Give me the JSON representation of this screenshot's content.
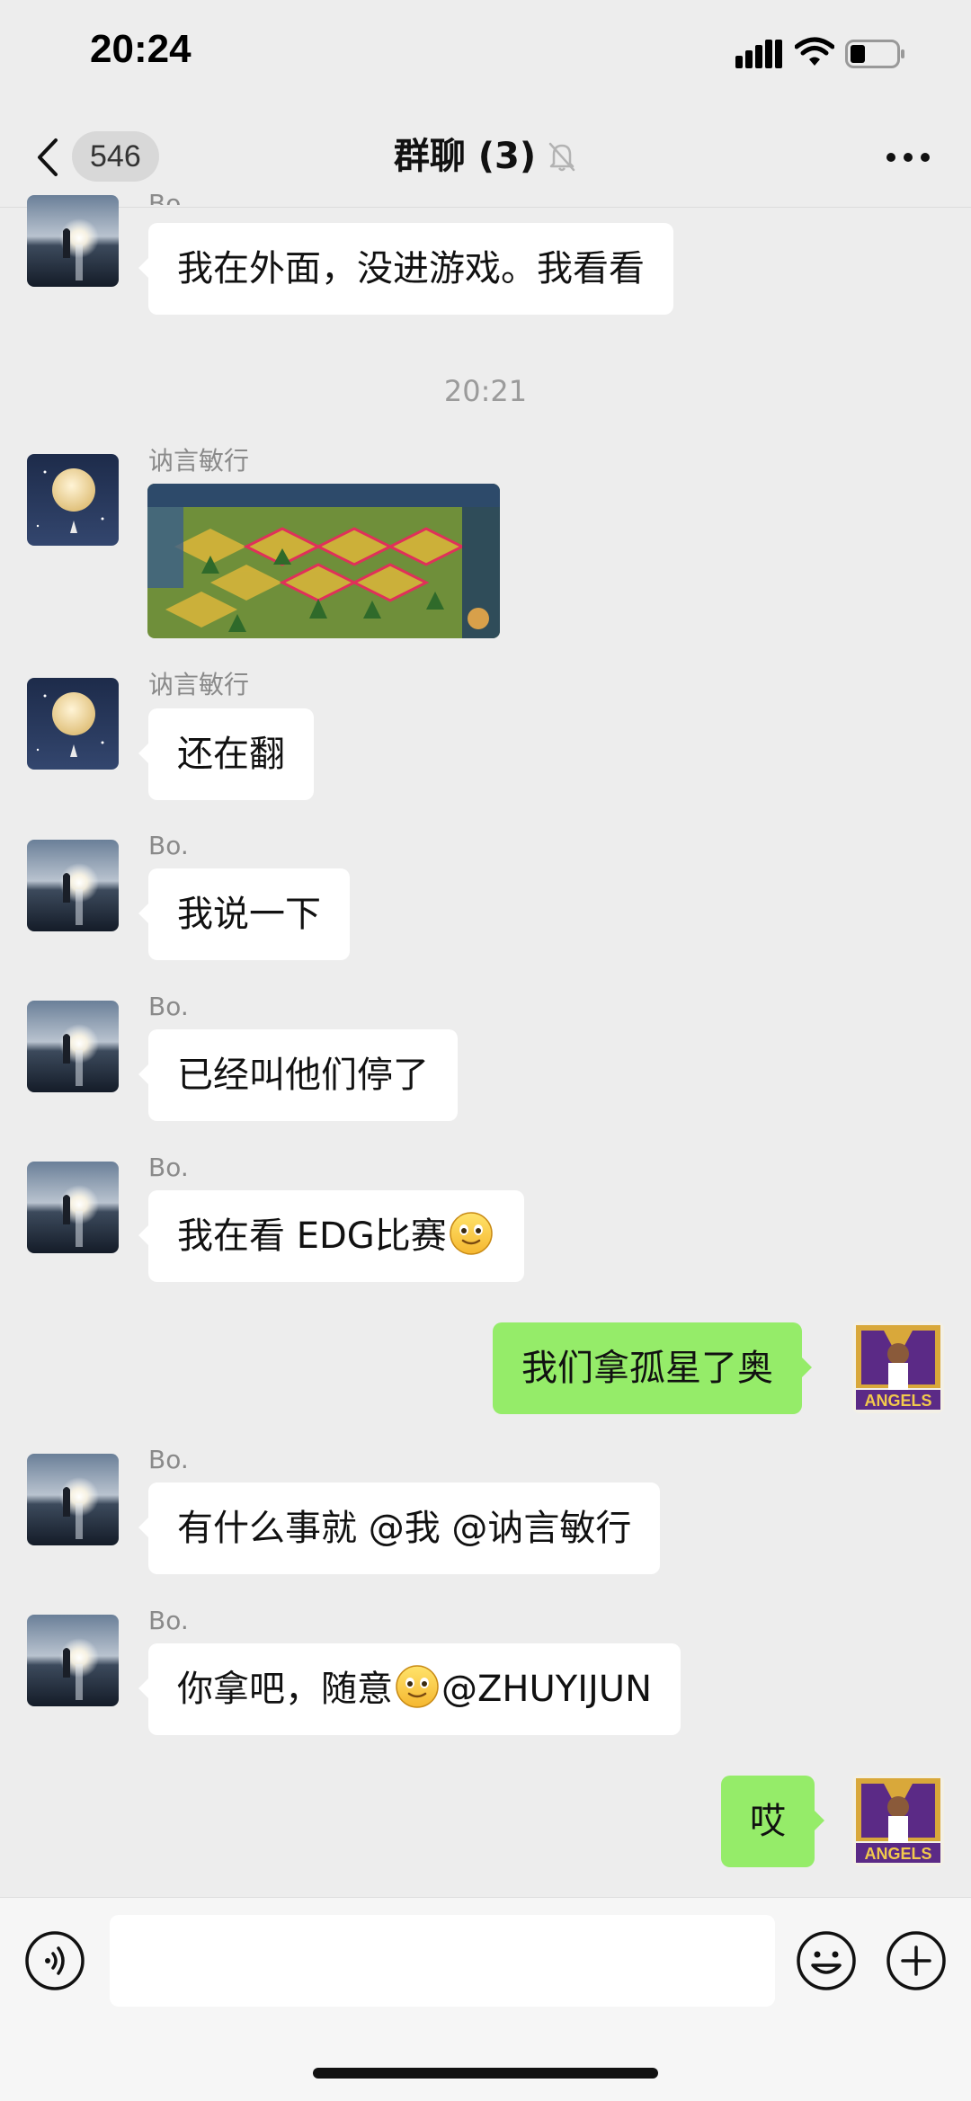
{
  "status_bar": {
    "time": "20:24"
  },
  "nav": {
    "back_count": "546",
    "title": "群聊 (3)",
    "muted": true
  },
  "messages": [
    {
      "type": "text",
      "side": "left",
      "sender": "Bo.",
      "text": "我在外面，没进游戏。我看看"
    },
    {
      "type": "timestamp",
      "text": "20:21"
    },
    {
      "type": "image",
      "side": "left",
      "sender": "讷言敏行",
      "image_desc": "game-map-screenshot"
    },
    {
      "type": "text",
      "side": "left",
      "sender": "讷言敏行",
      "text": "还在翻"
    },
    {
      "type": "text",
      "side": "left",
      "sender": "Bo.",
      "text": "我说一下"
    },
    {
      "type": "text",
      "side": "left",
      "sender": "Bo.",
      "text": "已经叫他们停了"
    },
    {
      "type": "text",
      "side": "left",
      "sender": "Bo.",
      "text": "我在看 EDG比赛",
      "emoji_after": "slight-smile"
    },
    {
      "type": "text",
      "side": "right",
      "text": "我们拿孤星了奥"
    },
    {
      "type": "text",
      "side": "left",
      "sender": "Bo.",
      "text": "有什么事就 @我 @讷言敏行"
    },
    {
      "type": "text",
      "side": "left",
      "sender": "Bo.",
      "text_before": "你拿吧，随意",
      "emoji": "slight-smile",
      "text_after": "@ZHUYIJUN"
    },
    {
      "type": "text",
      "side": "right",
      "text": "哎"
    }
  ],
  "my_avatar_label": "ANGELS",
  "input": {
    "placeholder": ""
  },
  "colors": {
    "background": "#ededed",
    "my_bubble": "#95ec69",
    "other_bubble": "#ffffff"
  }
}
